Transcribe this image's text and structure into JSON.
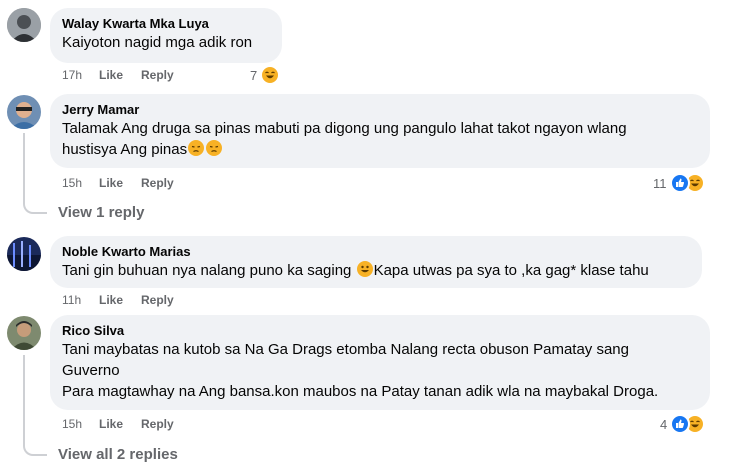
{
  "comments": [
    {
      "author": "Walay Kwarta Mka Luya",
      "lines": [
        "Kaiyoton nagid mga adik ron"
      ],
      "time": "17h",
      "like": "Like",
      "reply": "Reply",
      "reactions": "7"
    },
    {
      "author": "Jerry Mamar",
      "lines": [
        "Talamak Ang druga sa pinas mabuti pa digong ung pangulo lahat takot ngayon wlang",
        "hustisya Ang pinas"
      ],
      "time": "15h",
      "like": "Like",
      "reply": "Reply",
      "reactions": "11",
      "view_replies": "View 1 reply"
    },
    {
      "author": "Noble Kwarto Marias",
      "lines": [
        "Tani gin buhuan nya nalang puno ka saging",
        "Kapa utwas pa sya to ,ka gag* klase tahu"
      ],
      "time": "11h",
      "like": "Like",
      "reply": "Reply"
    },
    {
      "author": "Rico Silva",
      "lines": [
        "Tani maybatas na kutob sa Na Ga Drags etomba Nalang recta obuson Pamatay sang",
        "Guverno",
        "Para magtawhay na Ang bansa.kon maubos na Patay tanan adik wla na maybakal Droga."
      ],
      "time": "15h",
      "like": "Like",
      "reply": "Reply",
      "reactions": "4",
      "view_replies": "View all 2 replies"
    }
  ],
  "icons": {
    "like": "thumbs-up-icon",
    "haha": "laughing-face-icon",
    "sad": "pensive-face-icon",
    "grin": "grinning-face-icon"
  },
  "colors": {
    "like": "#1877f2",
    "haha": "#f7b125",
    "bubble": "#f0f2f5",
    "meta": "#65676b"
  }
}
